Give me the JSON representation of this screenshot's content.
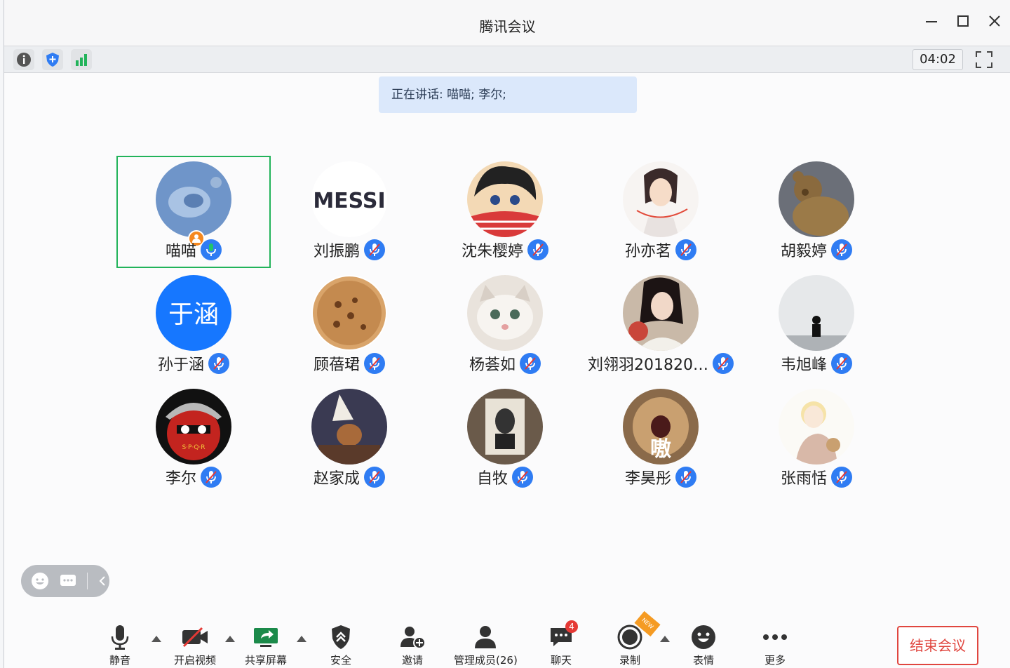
{
  "window": {
    "title": "腾讯会议",
    "controls": {
      "minimize": "—",
      "maximize": "☐",
      "close": "✕"
    }
  },
  "infobar": {
    "icons": [
      "info-icon",
      "shield-icon",
      "signal-icon"
    ],
    "timer": "04:02"
  },
  "speaking_banner": "正在讲话: 喵喵; 李尔;",
  "participants": [
    {
      "name": "喵喵",
      "mic": "on",
      "host": true,
      "avatar": "photo-blue",
      "active": true
    },
    {
      "name": "刘振鹏",
      "mic": "muted",
      "avatar": "messi"
    },
    {
      "name": "沈朱樱婷",
      "mic": "muted",
      "avatar": "anime-boy"
    },
    {
      "name": "孙亦茗",
      "mic": "muted",
      "avatar": "anime-girl"
    },
    {
      "name": "胡毅婷",
      "mic": "muted",
      "avatar": "teddy-bear"
    },
    {
      "name": "孙于涵",
      "mic": "muted",
      "avatar": "text",
      "avatar_text": "于涵"
    },
    {
      "name": "顾蓓珺",
      "mic": "muted",
      "avatar": "cookie"
    },
    {
      "name": "杨荟如",
      "mic": "muted",
      "avatar": "cat"
    },
    {
      "name": "刘翎羽2018200...",
      "mic": "muted",
      "avatar": "girl-photo"
    },
    {
      "name": "韦旭峰",
      "mic": "muted",
      "avatar": "sea"
    },
    {
      "name": "李尔",
      "mic": "muted",
      "avatar": "spqr-ball"
    },
    {
      "name": "赵家成",
      "mic": "muted",
      "avatar": "jerry"
    },
    {
      "name": "自牧",
      "mic": "muted",
      "avatar": "lincoln"
    },
    {
      "name": "李昊彤",
      "mic": "muted",
      "avatar": "cat-scream",
      "avatar_text": "嗷"
    },
    {
      "name": "张雨恬",
      "mic": "muted",
      "avatar": "sketch"
    }
  ],
  "toolbar": {
    "mute": "静音",
    "video": "开启视频",
    "share": "共享屏幕",
    "security": "安全",
    "invite": "邀请",
    "members": "管理成员(26)",
    "chat": "聊天",
    "chat_badge": "4",
    "record": "录制",
    "record_tag": "NEW",
    "emoji": "表情",
    "more": "更多",
    "end": "结束会议"
  },
  "colors": {
    "accent": "#2f7cf3",
    "active_border": "#22b35a",
    "end": "#e0463f",
    "banner": "#dbe8fb"
  }
}
